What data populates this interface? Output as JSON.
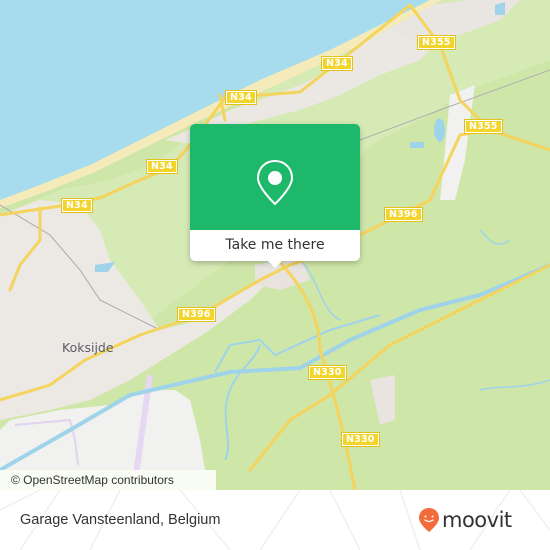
{
  "map": {
    "road_labels": [
      {
        "id": "n34-a",
        "text": "N34"
      },
      {
        "id": "n34-b",
        "text": "N34"
      },
      {
        "id": "n34-c",
        "text": "N34"
      },
      {
        "id": "n34-d",
        "text": "N34"
      },
      {
        "id": "n355-a",
        "text": "N355"
      },
      {
        "id": "n355-b",
        "text": "N355"
      },
      {
        "id": "n396-a",
        "text": "N396"
      },
      {
        "id": "n396-b",
        "text": "N396"
      },
      {
        "id": "n330-a",
        "text": "N330"
      },
      {
        "id": "n330-b",
        "text": "N330"
      }
    ],
    "places": [
      {
        "id": "koksijde",
        "text": "Koksijde"
      }
    ],
    "colors": {
      "sea": "#a7dbee",
      "beach": "#f5eab9",
      "land_green": "#cfe6a9",
      "urban": "#ece8e4",
      "road": "#f4d45c",
      "water": "#9fd3ea",
      "airfield": "#f1f1ef"
    }
  },
  "popup": {
    "pin_icon": "location-pin-icon",
    "button_label": "Take me there",
    "accent_color": "#1db86a"
  },
  "attribution": "© OpenStreetMap contributors",
  "footer": {
    "place_name": "Garage Vansteenland, Belgium",
    "brand": "moovit",
    "brand_color": "#f26b3a"
  }
}
